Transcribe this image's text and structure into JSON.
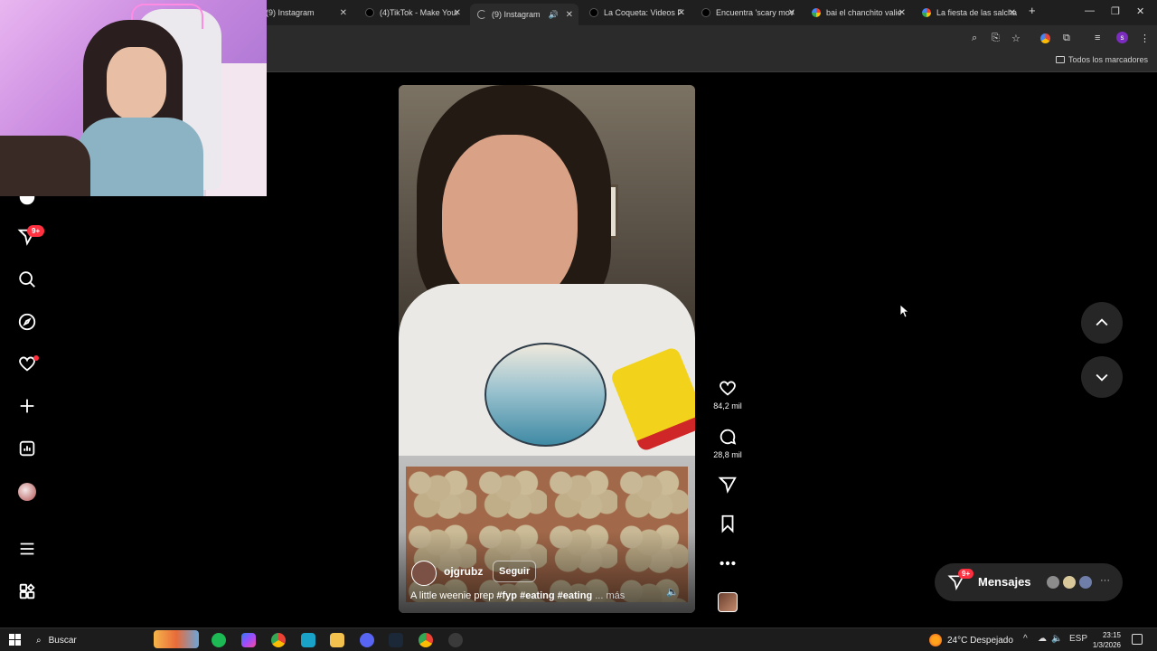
{
  "browser": {
    "tabs": [
      {
        "label": "(9) Instagram",
        "favicon": "instagram-icon"
      },
      {
        "label": "(4)TikTok - Make Your",
        "favicon": "tiktok-icon"
      },
      {
        "label": "(9) Instagram",
        "favicon": "loading-icon",
        "active": true
      },
      {
        "label": "La Coqueta: Videos F",
        "favicon": "tiktok-icon"
      },
      {
        "label": "Encuentra 'scary mov",
        "favicon": "tiktok-icon"
      },
      {
        "label": "bai el chanchito valie",
        "favicon": "google-icon"
      },
      {
        "label": "La fiesta de las salcha",
        "favicon": "google-icon"
      }
    ],
    "new_tab": "+",
    "bookmarks_all": "Todos los marcadores",
    "profile_initial": "s"
  },
  "sidebar": {
    "notifications_badge": "9+"
  },
  "reel": {
    "username": "ojgrubz",
    "follow_label": "Seguir",
    "caption_text": "A little weenie prep",
    "hashtags": "#fyp #eating #eating",
    "more_label": "... más",
    "likes": "84,2 mil",
    "comments": "28,8 mil"
  },
  "messages": {
    "label": "Mensajes",
    "badge": "9+"
  },
  "taskbar": {
    "search_label": "Buscar",
    "weather": "24°C  Despejado",
    "language": "ESP",
    "time": "23:15",
    "date": "1/3/2026"
  },
  "colors": {
    "badge_red": "#ff3040",
    "page_bg": "#000000",
    "chrome_bg": "#1f1f1f"
  }
}
